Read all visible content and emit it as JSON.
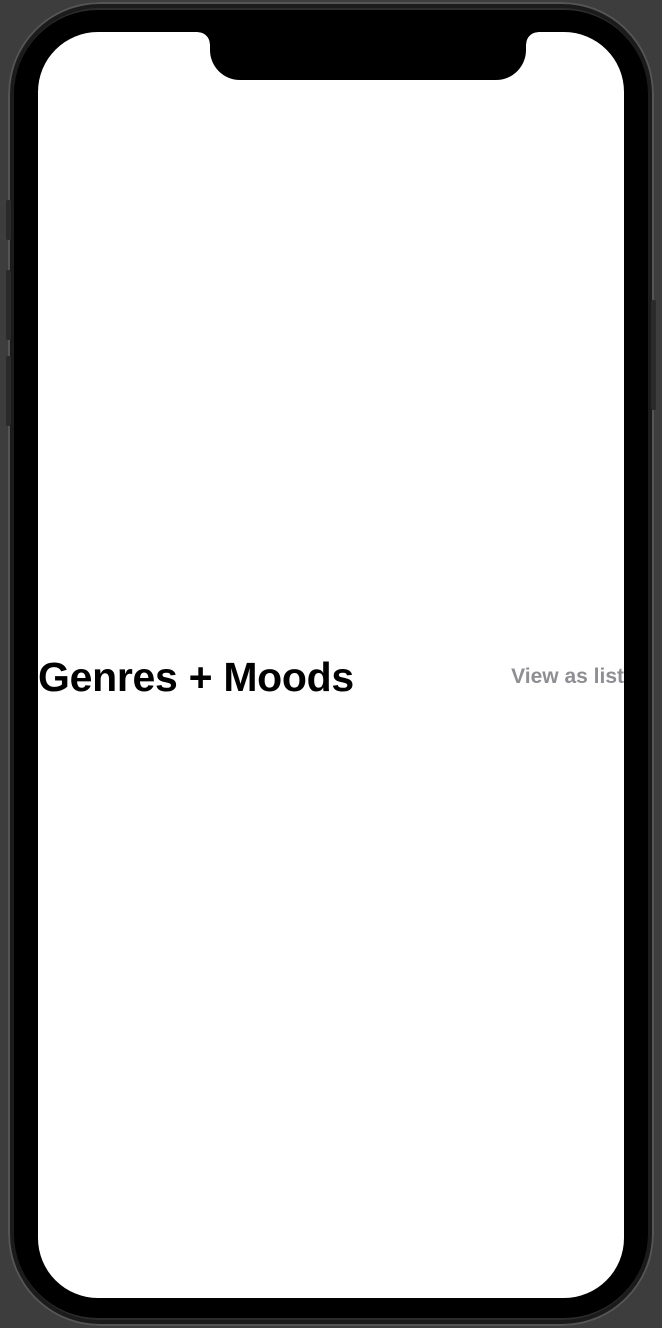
{
  "section": {
    "title": "Genres + Moods",
    "link_label": "View as list"
  },
  "colors": {
    "title": "#000000",
    "link": "#8e8e93",
    "screen_background": "#ffffff",
    "device_frame": "#2c2c2c"
  }
}
